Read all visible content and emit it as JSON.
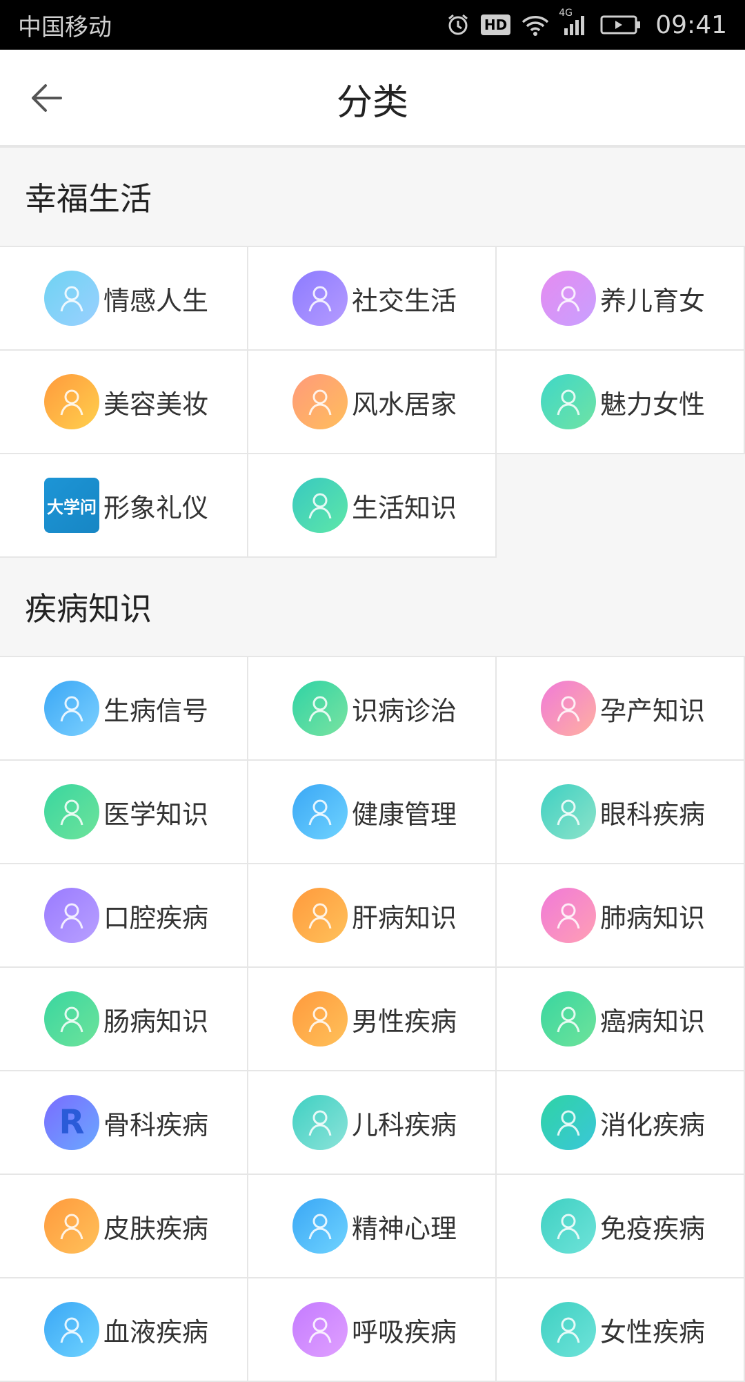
{
  "status_bar": {
    "carrier": "中国移动",
    "network": "4G",
    "hd": "HD",
    "time": "09:41"
  },
  "header": {
    "title": "分类"
  },
  "sections": [
    {
      "title": "幸福生活",
      "items": [
        {
          "label": "情感人生",
          "icon": "woman-sketch-icon",
          "colors": [
            "#6fd3f2",
            "#9ad0ff"
          ]
        },
        {
          "label": "社交生活",
          "icon": "people-group-icon",
          "colors": [
            "#8c7bff",
            "#b59bff"
          ]
        },
        {
          "label": "养儿育女",
          "icon": "chat-bubble-icon",
          "colors": [
            "#e58bf0",
            "#c8a0ff"
          ]
        },
        {
          "label": "美容美妆",
          "icon": "magic-wand-icon",
          "colors": [
            "#ff9a3d",
            "#ffd04d"
          ]
        },
        {
          "label": "风水居家",
          "icon": "tooth-house-icon",
          "colors": [
            "#ff9a7a",
            "#ffbe5c"
          ]
        },
        {
          "label": "魅力女性",
          "icon": "woman-face-icon",
          "colors": [
            "#3fd7c7",
            "#6fe3a4"
          ]
        },
        {
          "label": "形象礼仪",
          "icon": "daxuewen-logo-icon",
          "colors": [
            "#1d95d6",
            "#1786c4"
          ],
          "text": "大学问"
        },
        {
          "label": "生活知识",
          "icon": "cartoon-character-icon",
          "colors": [
            "#38c9c0",
            "#5ee7a8"
          ]
        }
      ]
    },
    {
      "title": "疾病知识",
      "items": [
        {
          "label": "生病信号",
          "icon": "trend-chart-icon",
          "colors": [
            "#3aa7f5",
            "#7cd0ff"
          ]
        },
        {
          "label": "识病诊治",
          "icon": "doctor-desk-icon",
          "colors": [
            "#2fd3a5",
            "#7ae3a0"
          ]
        },
        {
          "label": "孕产知识",
          "icon": "mushroom-icon",
          "colors": [
            "#f07ad8",
            "#ffb0a0"
          ]
        },
        {
          "label": "医学知识",
          "icon": "sketch-figure-icon",
          "colors": [
            "#39d6a0",
            "#6ee39a"
          ]
        },
        {
          "label": "健康管理",
          "icon": "businessman-key-icon",
          "colors": [
            "#3aa7f5",
            "#6fd3ff"
          ]
        },
        {
          "label": "眼科疾病",
          "icon": "robot-box-icon",
          "colors": [
            "#3fd0c2",
            "#8ce3c9"
          ]
        },
        {
          "label": "口腔疾病",
          "icon": "tooth-icon",
          "colors": [
            "#9a7bff",
            "#b8a0ff"
          ]
        },
        {
          "label": "肝病知识",
          "icon": "girl-cartoon-icon",
          "colors": [
            "#ff9a3d",
            "#ffc15a"
          ]
        },
        {
          "label": "肺病知识",
          "icon": "blackboard-teacher-icon",
          "colors": [
            "#f07ad8",
            "#ff9fb4"
          ]
        },
        {
          "label": "肠病知识",
          "icon": "group-figures-icon",
          "colors": [
            "#39d6a0",
            "#6ee39a"
          ]
        },
        {
          "label": "男性疾病",
          "icon": "astro-boy-icon",
          "colors": [
            "#ff9a3d",
            "#ffc15a"
          ]
        },
        {
          "label": "癌病知识",
          "icon": "flower-icon",
          "colors": [
            "#39d6a0",
            "#6ee39a"
          ]
        },
        {
          "label": "骨科疾病",
          "icon": "r-letter-icon",
          "colors": [
            "#7a6cff",
            "#6aa8ff"
          ],
          "text": "R"
        },
        {
          "label": "儿科疾病",
          "icon": "ice-cream-icon",
          "colors": [
            "#3fd0c2",
            "#8ce3d9"
          ]
        },
        {
          "label": "消化疾病",
          "icon": "robot-face-icon",
          "colors": [
            "#2fd3a5",
            "#3ac7d8"
          ]
        },
        {
          "label": "皮肤疾病",
          "icon": "girl-standing-icon",
          "colors": [
            "#ff9a3d",
            "#ffc15a"
          ]
        },
        {
          "label": "精神心理",
          "icon": "glasses-man-icon",
          "colors": [
            "#3aa7f5",
            "#6fd3ff"
          ]
        },
        {
          "label": "免疫疾病",
          "icon": "doctor-computer-icon",
          "colors": [
            "#3fd0c2",
            "#6ee3d9"
          ]
        },
        {
          "label": "血液疾病",
          "icon": "cartoon-blue-icon",
          "colors": [
            "#3aa7f5",
            "#6fd3ff"
          ]
        },
        {
          "label": "呼吸疾病",
          "icon": "star-crown-icon",
          "colors": [
            "#c47bff",
            "#e0a0ff"
          ]
        },
        {
          "label": "女性疾病",
          "icon": "cartoon-teal-icon",
          "colors": [
            "#3fd0c2",
            "#6ee3d9"
          ]
        }
      ]
    }
  ]
}
